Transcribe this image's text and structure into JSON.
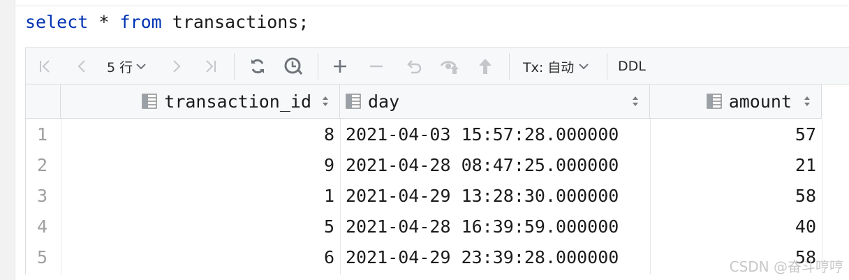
{
  "editor": {
    "sql": {
      "kw1": "select",
      "star": "*",
      "kw2": "from",
      "rest": "transactions;"
    }
  },
  "toolbar": {
    "row_count": "5 行",
    "tx_mode": "Tx: 自动",
    "ddl": "DDL"
  },
  "table": {
    "columns": [
      {
        "label": "transaction_id"
      },
      {
        "label": "day"
      },
      {
        "label": "amount"
      }
    ],
    "rows": [
      {
        "n": "1",
        "transaction_id": "8",
        "day": "2021-04-03 15:57:28.000000",
        "amount": "57"
      },
      {
        "n": "2",
        "transaction_id": "9",
        "day": "2021-04-28 08:47:25.000000",
        "amount": "21"
      },
      {
        "n": "3",
        "transaction_id": "1",
        "day": "2021-04-29 13:28:30.000000",
        "amount": "58"
      },
      {
        "n": "4",
        "transaction_id": "5",
        "day": "2021-04-28 16:39:59.000000",
        "amount": "40"
      },
      {
        "n": "5",
        "transaction_id": "6",
        "day": "2021-04-29 23:39:28.000000",
        "amount": "58"
      }
    ]
  },
  "watermark": "CSDN @奋斗哼哼",
  "colors": {
    "keyword": "#0033b3",
    "icon_active": "#6f737a",
    "icon_disabled": "#c4c6ca",
    "header_bg": "#f7f8fa"
  }
}
